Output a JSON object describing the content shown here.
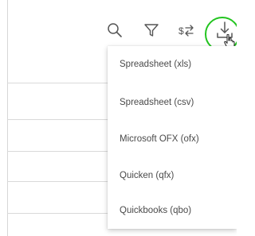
{
  "toolbar": {
    "icons": [
      "search-icon",
      "filter-icon",
      "swap-icon",
      "download-icon"
    ],
    "focus_color": "#22c41f"
  },
  "export_menu": {
    "items": [
      "Spreadsheet (xls)",
      "Spreadsheet (csv)",
      "Microsoft OFX (ofx)",
      "Quicken (qfx)",
      "Quickbooks (qbo)"
    ]
  }
}
